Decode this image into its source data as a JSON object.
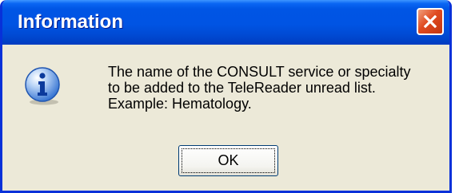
{
  "dialog": {
    "title": "Information",
    "close_icon": "close-icon",
    "icon": "information-icon",
    "message": "The name of the CONSULT service or specialty\nto be added to the TeleReader unread list.\nExample:  Hematology.",
    "ok_label": "OK"
  },
  "colors": {
    "titlebar": "#0054e3",
    "dialog_background": "#ece9d8",
    "close_button": "#e04a20",
    "window_border": "#0831d9"
  }
}
